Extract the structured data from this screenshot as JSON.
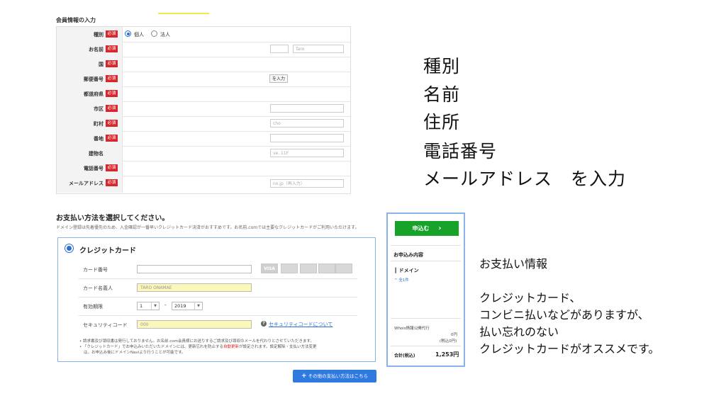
{
  "form": {
    "section_title": "会員情報の入力",
    "required_badge": "必須",
    "rows": [
      {
        "label": "種別",
        "required": true
      },
      {
        "label": "お名前",
        "required": true
      },
      {
        "label": "国",
        "required": true
      },
      {
        "label": "郵便番号",
        "required": true
      },
      {
        "label": "都道府県",
        "required": true
      },
      {
        "label": "市区",
        "required": true
      },
      {
        "label": "町村",
        "required": true
      },
      {
        "label": "番地",
        "required": true
      },
      {
        "label": "建物名",
        "required": false
      },
      {
        "label": "電話番号",
        "required": true
      },
      {
        "label": "メールアドレス",
        "required": true
      }
    ],
    "type_options": [
      "個人",
      "法人"
    ],
    "name_first_placeholder": "Taro",
    "zip_button_fragment": "を入力",
    "town_fragment": "cho",
    "building_fragment": "ve. 11F",
    "email_fragment": "no.jp（再入力）"
  },
  "annotation_top": [
    "種別",
    "名前",
    "住所",
    "電話番号",
    "メールアドレス　を入力"
  ],
  "annotation_pay": [
    "お支払い情報",
    "",
    "クレジットカード、",
    "コンビニ払いなどがありますが、",
    "払い忘れのない",
    "クレジットカードがオススメです。"
  ],
  "payment": {
    "title": "お支払い方法を選択してください。",
    "desc": "ドメイン登録は先着優先のため、入金確認が一番早いクレジットカード決済がおすすめです。お名前.comでは主要なクレジットカードがご利用いただけます。",
    "method": "クレジットカード",
    "card_number_label": "カード番号",
    "card_holder_label": "カード名義人",
    "card_holder_value": "TARO ONAMAE",
    "expiry_label": "有効期限",
    "expiry_month": "1",
    "expiry_sep": "-",
    "expiry_year": "2019",
    "cvc_label": "セキュリティコード",
    "cvc_value": "000",
    "cvc_help": "セキュリティコードについて",
    "card_brands": [
      "VISA",
      "",
      "",
      "",
      ""
    ],
    "note1": "請求書及び領収書は発行しておりません。お名前.com会員様にお送りするご請求及び領収のメールを代わりとさせていただきます。",
    "note2a": "「クレジットカード」でお申込みいただいたドメインには、更新忘れを防止する",
    "note2_red": "自動更新",
    "note2b": "が設定されます。設定解除・支払い方法変更",
    "note3": "は、お申込み後にドメインNaviより行うことが可能です。",
    "other_methods": "その他の支払い方法はこちら"
  },
  "summary": {
    "apply_button": "申込む",
    "apply_arrow": "›",
    "heading": "お申込み内容",
    "domain_label": "ドメイン",
    "domain_link": "全1件",
    "whois_label": "Whois情報公開代行",
    "whois_price": "0円",
    "whois_tax": "(税込0円)",
    "total_label": "合計(税込)",
    "total_value": "1,253円"
  }
}
